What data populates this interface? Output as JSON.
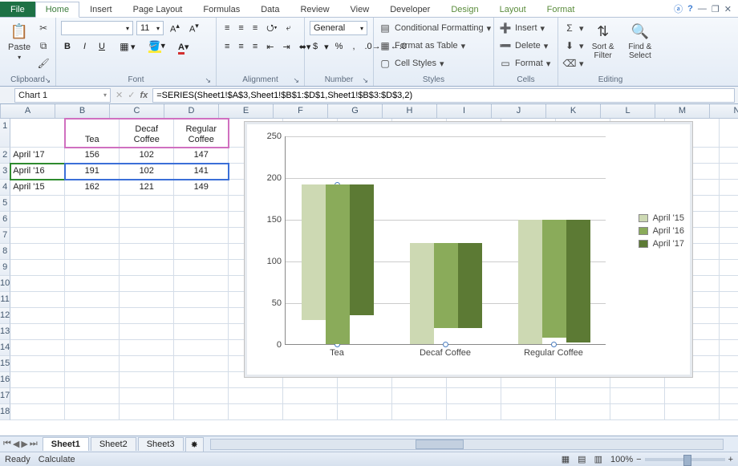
{
  "tabs": {
    "file": "File",
    "home": "Home",
    "insert": "Insert",
    "pagelayout": "Page Layout",
    "formulas": "Formulas",
    "data": "Data",
    "review": "Review",
    "view": "View",
    "developer": "Developer",
    "design": "Design",
    "layout": "Layout",
    "format": "Format"
  },
  "ribbon": {
    "clipboard": {
      "label": "Clipboard",
      "paste": "Paste"
    },
    "font": {
      "label": "Font",
      "size": "11",
      "bold": "B",
      "italic": "I",
      "underline": "U"
    },
    "alignment": {
      "label": "Alignment"
    },
    "number": {
      "label": "Number",
      "general": "General",
      "currency": "$",
      "percent": "%",
      "comma": ","
    },
    "styles": {
      "label": "Styles",
      "cf": "Conditional Formatting",
      "ft": "Format as Table",
      "cs": "Cell Styles"
    },
    "cells": {
      "label": "Cells",
      "insert": "Insert",
      "delete": "Delete",
      "format": "Format"
    },
    "editing": {
      "label": "Editing",
      "sortfilter": "Sort & Filter",
      "findselect": "Find & Select"
    }
  },
  "namebox": "Chart 1",
  "formula": "=SERIES(Sheet1!$A$3,Sheet1!$B$1:$D$1,Sheet1!$B$3:$D$3,2)",
  "columns": [
    "A",
    "B",
    "C",
    "D",
    "E",
    "F",
    "G",
    "H",
    "I",
    "J",
    "K",
    "L",
    "M",
    "N"
  ],
  "rows": [
    "1",
    "2",
    "3",
    "4",
    "5",
    "6",
    "7",
    "8",
    "9",
    "10",
    "11",
    "12",
    "13",
    "14",
    "15",
    "16",
    "17",
    "18"
  ],
  "headers": {
    "B": "Tea",
    "C": "Decaf Coffee",
    "D": "Regular Coffee"
  },
  "rowLabels": {
    "2": "April '17",
    "3": "April '16",
    "4": "April '15"
  },
  "data": {
    "B2": "156",
    "C2": "102",
    "D2": "147",
    "B3": "191",
    "C3": "102",
    "D3": "141",
    "B4": "162",
    "C4": "121",
    "D4": "149"
  },
  "chart_data": {
    "type": "bar",
    "categories": [
      "Tea",
      "Decaf Coffee",
      "Regular Coffee"
    ],
    "series": [
      {
        "name": "April '15",
        "values": [
          162,
          121,
          149
        ]
      },
      {
        "name": "April '16",
        "values": [
          191,
          102,
          141
        ]
      },
      {
        "name": "April '17",
        "values": [
          156,
          102,
          147
        ]
      }
    ],
    "ylim": [
      0,
      250
    ],
    "yticks": [
      0,
      50,
      100,
      150,
      200,
      250
    ],
    "title": "",
    "xlabel": "",
    "ylabel": "",
    "selected_series": "April '16"
  },
  "sheets": {
    "s1": "Sheet1",
    "s2": "Sheet2",
    "s3": "Sheet3"
  },
  "status": {
    "ready": "Ready",
    "calc": "Calculate",
    "zoom": "100%"
  }
}
